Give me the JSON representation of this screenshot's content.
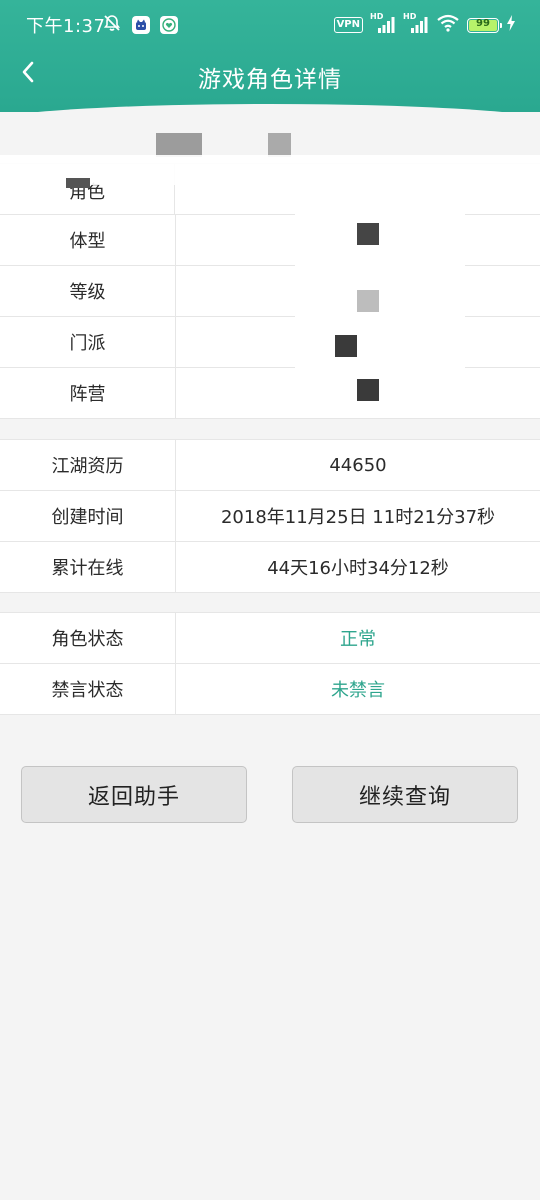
{
  "status_bar": {
    "time": "下午1:37",
    "vpn": "VPN",
    "hd1": "HD",
    "hd2": "HD",
    "battery": "99",
    "battery_level": 0.99
  },
  "header": {
    "title": "游戏角色详情"
  },
  "table_basic": {
    "rows": [
      {
        "label": "角色",
        "value": ""
      },
      {
        "label": "体型",
        "value": ""
      },
      {
        "label": "等级",
        "value": ""
      },
      {
        "label": "门派",
        "value": ""
      },
      {
        "label": "阵营",
        "value": ""
      }
    ]
  },
  "table_stats": {
    "rows": [
      {
        "label": "江湖资历",
        "value": "44650"
      },
      {
        "label": "创建时间",
        "value": "2018年11月25日 11时21分37秒"
      },
      {
        "label": "累计在线",
        "value": "44天16小时34分12秒"
      }
    ]
  },
  "table_status": {
    "rows": [
      {
        "label": "角色状态",
        "value": "正常"
      },
      {
        "label": "禁言状态",
        "value": "未禁言"
      }
    ]
  },
  "buttons": {
    "back_assistant": "返回助手",
    "continue_query": "继续查询"
  },
  "colors": {
    "brand": "#2aa890",
    "status_text": "#2ea58d",
    "button_bg": "#e4e4e4",
    "background": "#f4f4f4"
  },
  "icons": {
    "back": "chevron-left-icon",
    "dnd": "bell-off-icon",
    "signal": "signal-icon",
    "wifi": "wifi-icon",
    "battery": "battery-icon",
    "charging": "lightning-icon"
  }
}
